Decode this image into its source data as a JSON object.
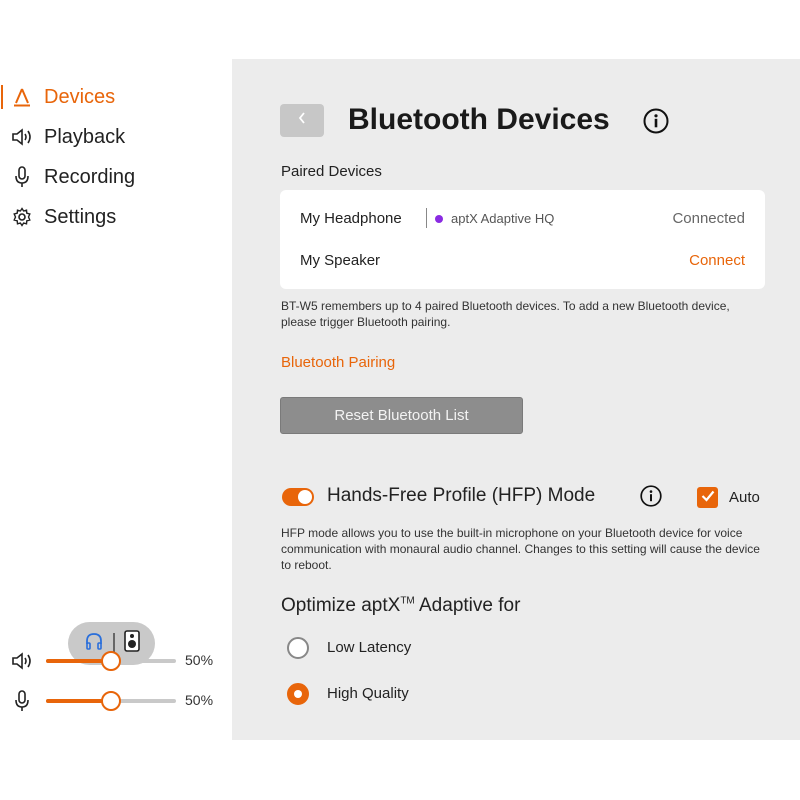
{
  "sidebar": {
    "items": [
      {
        "label": "Devices",
        "icon": "devices-icon",
        "active": true
      },
      {
        "label": "Playback",
        "icon": "speaker-icon",
        "active": false
      },
      {
        "label": "Recording",
        "icon": "microphone-icon",
        "active": false
      },
      {
        "label": "Settings",
        "icon": "gear-icon",
        "active": false
      }
    ],
    "device_switch": {
      "left_icon": "headphone-icon",
      "right_icon": "speaker-box-icon"
    },
    "volume": {
      "playback_value": 0.5,
      "playback_label": "50%",
      "recording_value": 0.5,
      "recording_label": "50%"
    }
  },
  "main": {
    "title": "Bluetooth Devices",
    "paired_label": "Paired Devices",
    "devices": [
      {
        "name": "My Headphone",
        "codec": "aptX Adaptive HQ",
        "status": "Connected"
      },
      {
        "name": "My Speaker",
        "codec": "",
        "status": "Connect"
      }
    ],
    "paired_note": "BT-W5 remembers up to 4 paired Bluetooth devices. To add a new Bluetooth device, please trigger Bluetooth pairing.",
    "pairing_link": "Bluetooth Pairing",
    "reset_button": "Reset Bluetooth List",
    "hfp": {
      "title": "Hands-Free Profile (HFP) Mode",
      "enabled": true,
      "auto_label": "Auto",
      "auto_checked": true,
      "note": "HFP mode allows you to use the built-in microphone on your Bluetooth device for voice communication with monaural audio channel. Changes to this setting will cause the device to reboot."
    },
    "optimize": {
      "title_prefix": "Optimize aptX",
      "title_tm": "TM",
      "title_suffix": " Adaptive for",
      "options": [
        {
          "label": "Low Latency",
          "selected": false
        },
        {
          "label": "High Quality",
          "selected": true
        }
      ]
    }
  },
  "colors": {
    "accent": "#e8650a",
    "background": "#ececec",
    "codec_dot": "#8a2be2"
  }
}
